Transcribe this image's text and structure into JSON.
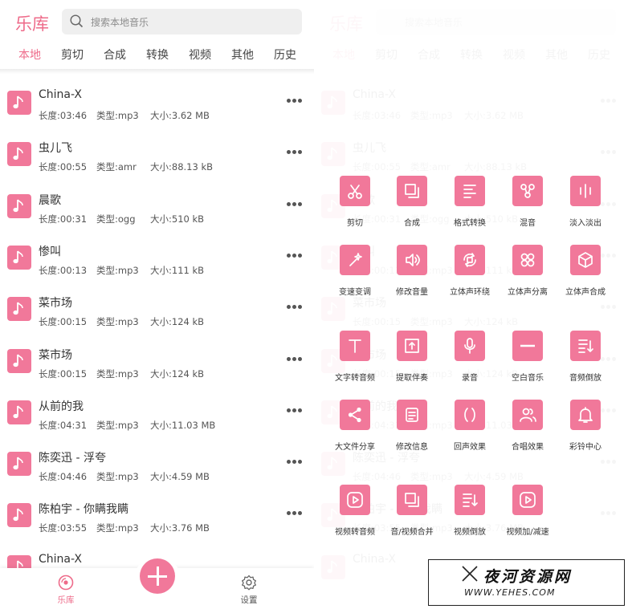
{
  "header": {
    "brand": "乐库",
    "search_placeholder": "搜索本地音乐"
  },
  "tabs": [
    {
      "label": "本地",
      "active": true
    },
    {
      "label": "剪切"
    },
    {
      "label": "合成"
    },
    {
      "label": "转换"
    },
    {
      "label": "视频"
    },
    {
      "label": "其他"
    },
    {
      "label": "历史"
    }
  ],
  "songs": [
    {
      "title": "China-X",
      "length": "长度:03:46",
      "type": "类型:mp3",
      "size": "大小:3.62 MB"
    },
    {
      "title": "虫儿飞",
      "length": "长度:00:55",
      "type": "类型:amr",
      "size": "大小:88.13 kB"
    },
    {
      "title": "晨歌",
      "length": "长度:00:31",
      "type": "类型:ogg",
      "size": "大小:510 kB"
    },
    {
      "title": "惨叫",
      "length": "长度:00:13",
      "type": "类型:mp3",
      "size": "大小:111 kB"
    },
    {
      "title": "菜市场",
      "length": "长度:00:15",
      "type": "类型:mp3",
      "size": "大小:124 kB"
    },
    {
      "title": "菜市场",
      "length": "长度:00:15",
      "type": "类型:mp3",
      "size": "大小:124 kB"
    },
    {
      "title": "从前的我",
      "length": "长度:04:31",
      "type": "类型:mp3",
      "size": "大小:11.03 MB"
    },
    {
      "title": "陈奕迅 - 浮夸",
      "length": "长度:04:46",
      "type": "类型:mp3",
      "size": "大小:4.59 MB"
    },
    {
      "title": "陈柏宇 - 你瞒我瞒",
      "length": "长度:03:55",
      "type": "类型:mp3",
      "size": "大小:3.76 MB"
    },
    {
      "title": "China-X",
      "length": "",
      "type": "",
      "size": ""
    }
  ],
  "bottom_nav": {
    "library_label": "乐库",
    "settings_label": "设置"
  },
  "tools": [
    {
      "label": "剪切",
      "icon": "scissors-icon"
    },
    {
      "label": "合成",
      "icon": "merge-icon"
    },
    {
      "label": "格式转换",
      "icon": "format-convert-icon"
    },
    {
      "label": "混音",
      "icon": "mix-icon"
    },
    {
      "label": "淡入淡出",
      "icon": "fade-icon"
    },
    {
      "label": "变速变调",
      "icon": "magic-wand-icon"
    },
    {
      "label": "修改音量",
      "icon": "volume-icon"
    },
    {
      "label": "立体声环绕",
      "icon": "surround-icon"
    },
    {
      "label": "立体声分离",
      "icon": "split-icon"
    },
    {
      "label": "立体声合成",
      "icon": "cube-icon"
    },
    {
      "label": "文字转音频",
      "icon": "text-icon"
    },
    {
      "label": "提取伴奏",
      "icon": "extract-icon"
    },
    {
      "label": "录音",
      "icon": "microphone-icon"
    },
    {
      "label": "空白音乐",
      "icon": "blank-icon"
    },
    {
      "label": "音频倒放",
      "icon": "reverse-icon"
    },
    {
      "label": "大文件分享",
      "icon": "share-icon"
    },
    {
      "label": "修改信息",
      "icon": "edit-info-icon"
    },
    {
      "label": "回声效果",
      "icon": "echo-icon"
    },
    {
      "label": "合唱效果",
      "icon": "chorus-icon"
    },
    {
      "label": "彩铃中心",
      "icon": "bell-icon"
    },
    {
      "label": "视频转音频",
      "icon": "video-to-audio-icon"
    },
    {
      "label": "音/视频合并",
      "icon": "av-merge-icon"
    },
    {
      "label": "视频倒放",
      "icon": "video-reverse-icon"
    },
    {
      "label": "视频加/减速",
      "icon": "video-speed-icon"
    }
  ],
  "watermark": {
    "title": "夜河资源网",
    "url": "WWW.YEHES.COM"
  },
  "colors": {
    "accent": "#f1789a",
    "brand_text": "#ee6b8a"
  }
}
